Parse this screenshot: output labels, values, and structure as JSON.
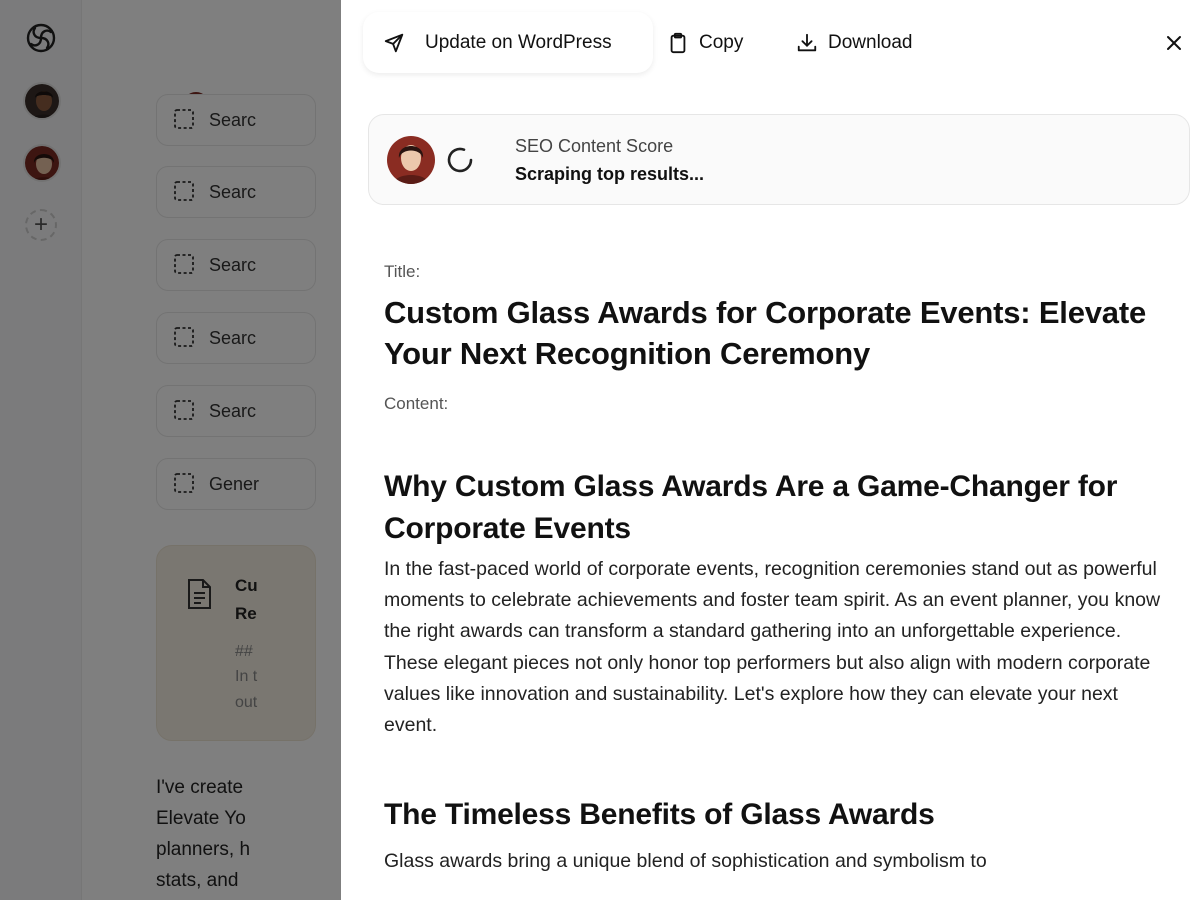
{
  "toolbar": {
    "update_label": "Update on WordPress",
    "copy_label": "Copy",
    "download_label": "Download"
  },
  "seo": {
    "label": "SEO Content Score",
    "status": "Scraping top results..."
  },
  "article": {
    "title_label": "Title:",
    "title": "Custom Glass Awards for Corporate Events: Elevate Your Next Recognition Ceremony",
    "content_label": "Content:",
    "sections": [
      {
        "heading": "Why Custom Glass Awards Are a Game-Changer for Corporate Events",
        "body": "In the fast-paced world of corporate events, recognition ceremonies stand out as powerful moments to celebrate achievements and foster team spirit. As an event planner, you know the right awards can transform a standard gathering into an unforgettable experience. These elegant pieces not only honor top performers but also align with modern corporate values like innovation and sustainability. Let's explore how they can elevate your next event."
      },
      {
        "heading": "The Timeless Benefits of Glass Awards",
        "body": "Glass awards bring a unique blend of sophistication and symbolism to"
      }
    ]
  },
  "chat": {
    "steps": [
      "Searc",
      "Searc",
      "Searc",
      "Searc",
      "Searc",
      "Gener"
    ],
    "doc_card": {
      "line1": "Cu",
      "line2": "Re",
      "line3": "##",
      "line4": "In t",
      "line5": "out"
    },
    "message_lines": [
      "I've create",
      "Elevate Yo",
      "planners, h",
      "stats, and"
    ]
  },
  "colors": {
    "overlay": "#000000",
    "doc_card_bg": "#f5efe3",
    "panel_bg": "#ffffff"
  },
  "icons": {
    "app_logo": "swirl-logo-icon",
    "update": "send-icon",
    "copy": "clipboard-icon",
    "download": "download-icon",
    "close": "close-icon",
    "step": "cursor-select-icon",
    "document": "document-icon",
    "loading": "spinner-icon",
    "add": "plus-icon"
  }
}
